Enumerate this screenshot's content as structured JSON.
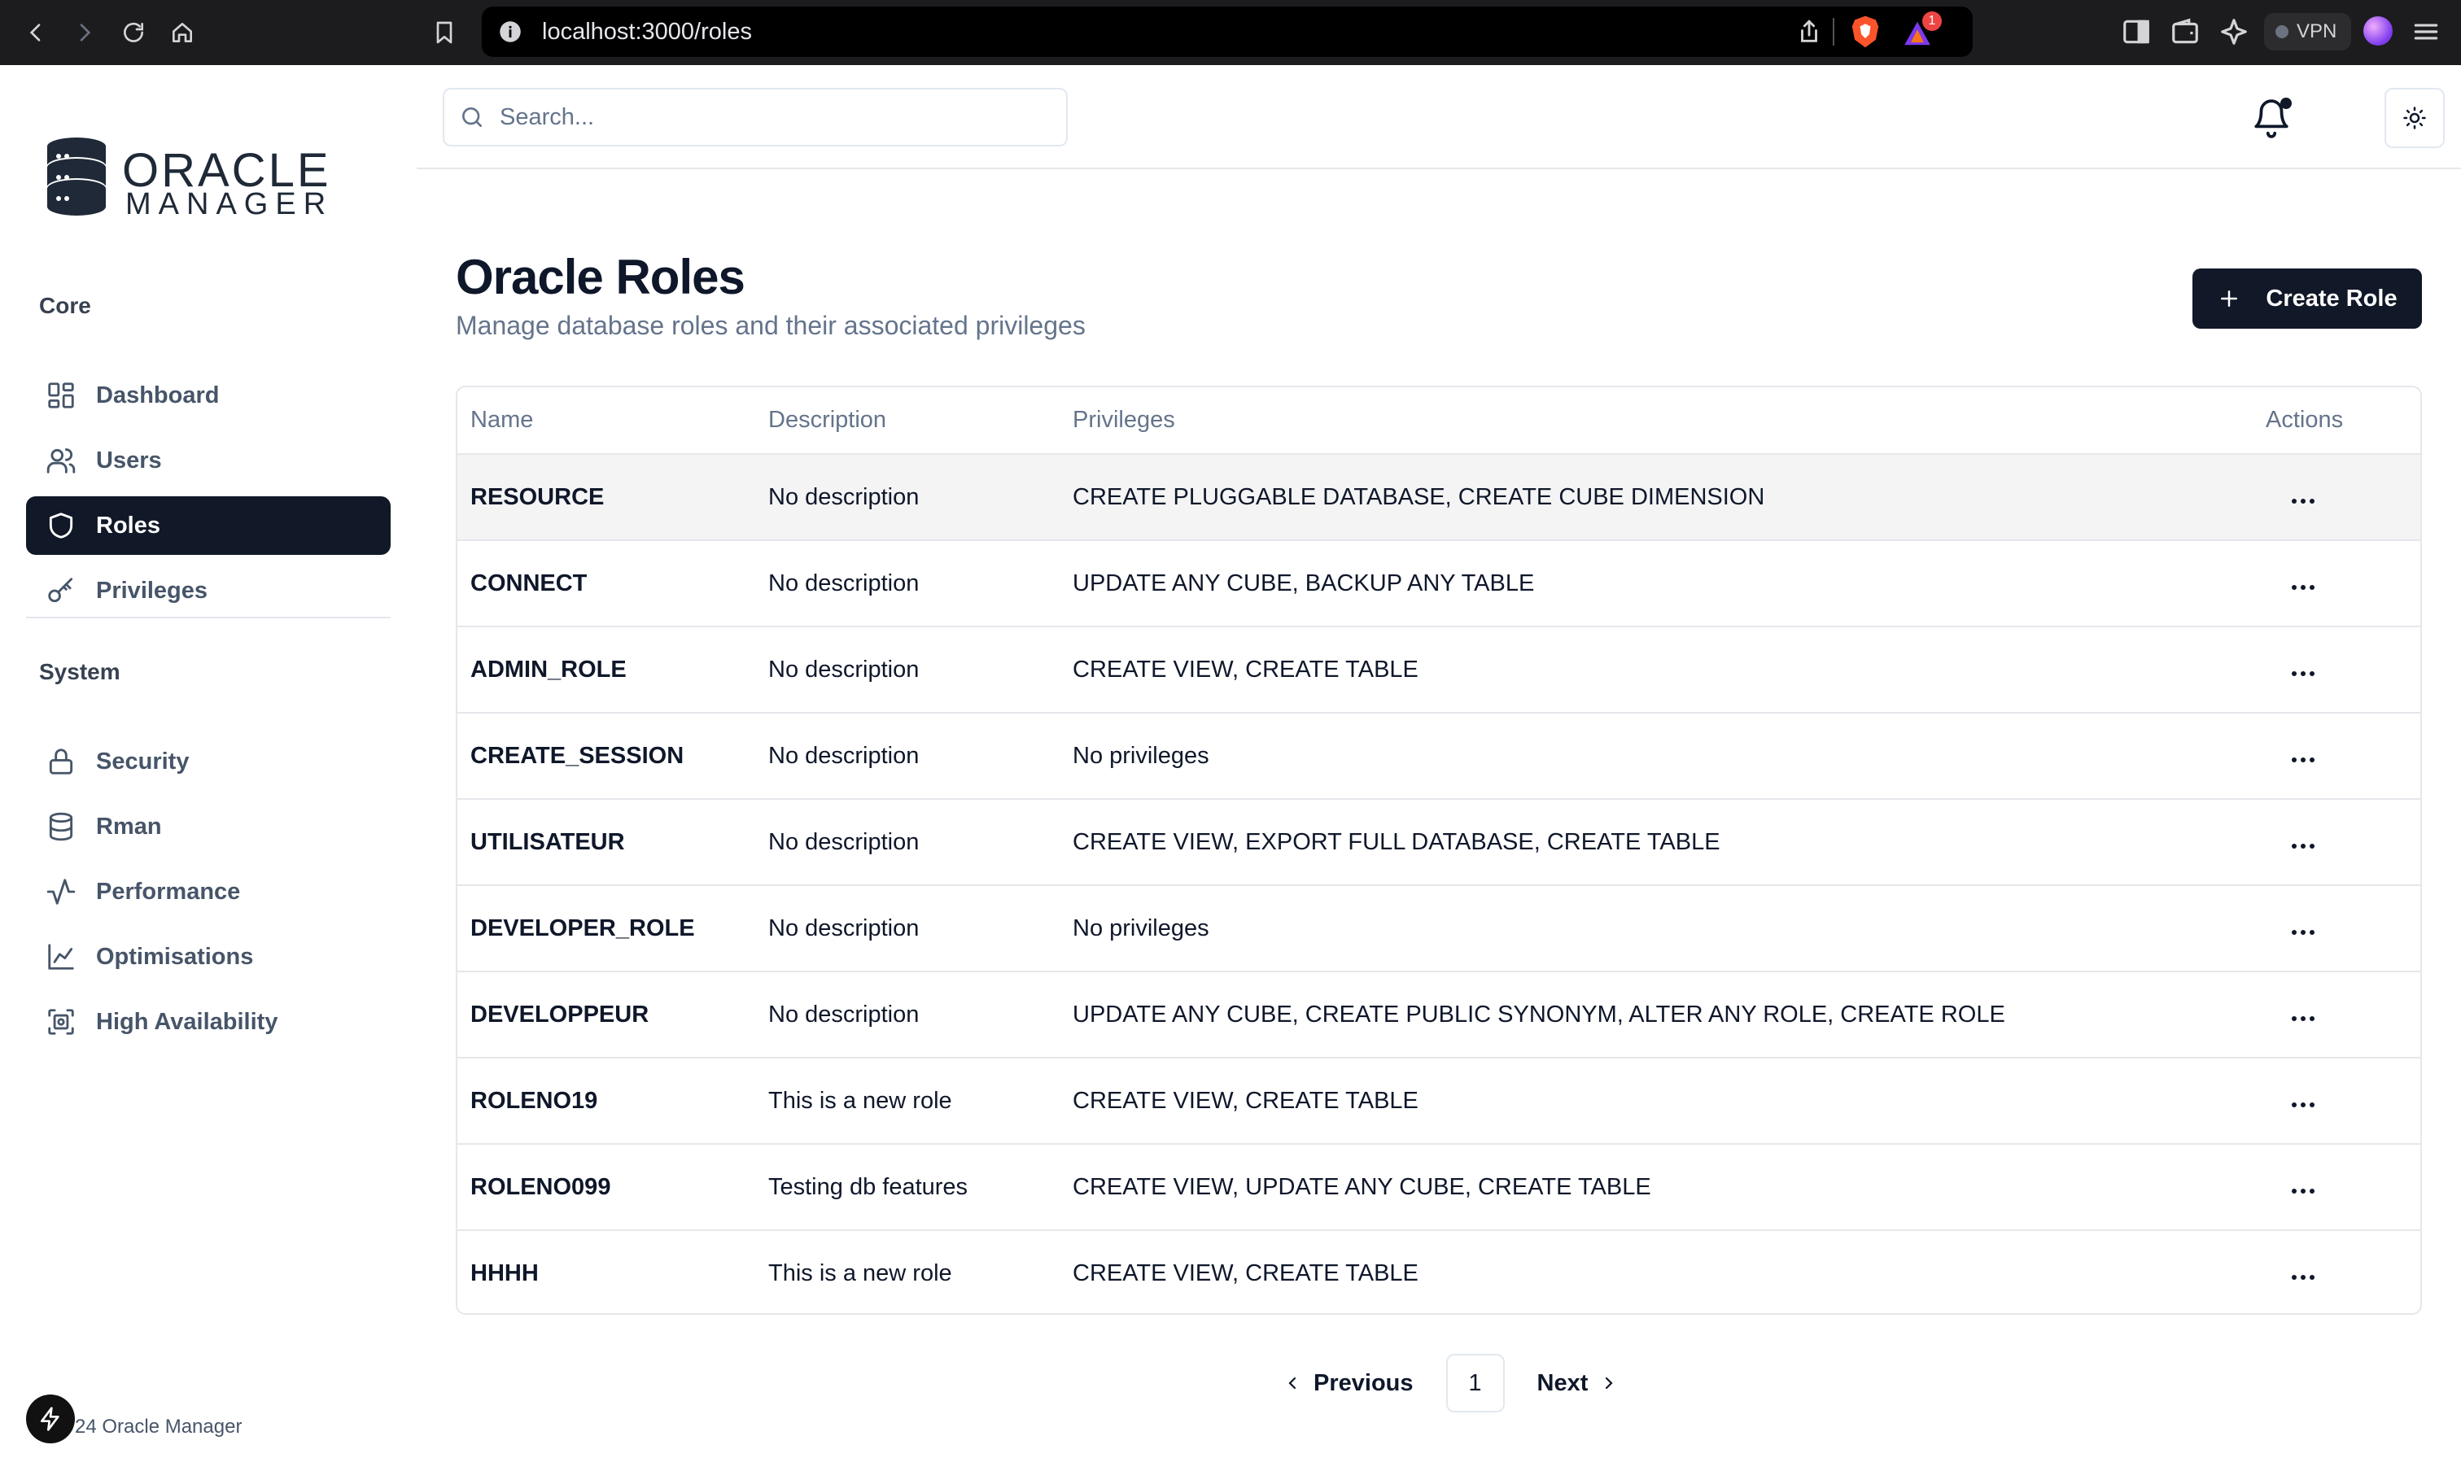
{
  "browser": {
    "url": "localhost:3000/roles",
    "vpn_label": "VPN",
    "rewards_badge": "1"
  },
  "brand": {
    "name_line1": "ORACLE",
    "name_line2": "MANAGER"
  },
  "sidebar": {
    "core_label": "Core",
    "core_items": [
      {
        "label": "Dashboard",
        "icon": "dashboard-icon"
      },
      {
        "label": "Users",
        "icon": "users-icon"
      },
      {
        "label": "Roles",
        "icon": "shield-icon",
        "active": true
      },
      {
        "label": "Privileges",
        "icon": "key-icon"
      }
    ],
    "system_label": "System",
    "system_items": [
      {
        "label": "Security",
        "icon": "lock-icon"
      },
      {
        "label": "Rman",
        "icon": "database-icon"
      },
      {
        "label": "Performance",
        "icon": "activity-icon"
      },
      {
        "label": "Optimisations",
        "icon": "line-chart-icon"
      },
      {
        "label": "High Availability",
        "icon": "server-icon"
      }
    ],
    "footer": "24 Oracle Manager"
  },
  "topbar": {
    "search_placeholder": "Search..."
  },
  "main": {
    "title": "Oracle Roles",
    "subtitle": "Manage database roles and their associated privileges",
    "create_button": "Create Role"
  },
  "table": {
    "headers": {
      "name": "Name",
      "description": "Description",
      "privileges": "Privileges",
      "actions": "Actions"
    },
    "rows": [
      {
        "name": "RESOURCE",
        "description": "No description",
        "privileges": "CREATE PLUGGABLE DATABASE, CREATE CUBE DIMENSION"
      },
      {
        "name": "CONNECT",
        "description": "No description",
        "privileges": "UPDATE ANY CUBE, BACKUP ANY TABLE"
      },
      {
        "name": "ADMIN_ROLE",
        "description": "No description",
        "privileges": "CREATE VIEW, CREATE TABLE"
      },
      {
        "name": "CREATE_SESSION",
        "description": "No description",
        "privileges": "No privileges"
      },
      {
        "name": "UTILISATEUR",
        "description": "No description",
        "privileges": "CREATE VIEW, EXPORT FULL DATABASE, CREATE TABLE"
      },
      {
        "name": "DEVELOPER_ROLE",
        "description": "No description",
        "privileges": "No privileges"
      },
      {
        "name": "DEVELOPPEUR",
        "description": "No description",
        "privileges": "UPDATE ANY CUBE, CREATE PUBLIC SYNONYM, ALTER ANY ROLE, CREATE ROLE"
      },
      {
        "name": "ROLENO19",
        "description": "This is a new role",
        "privileges": "CREATE VIEW, CREATE TABLE"
      },
      {
        "name": "ROLENO099",
        "description": "Testing db features",
        "privileges": "CREATE VIEW, UPDATE ANY CUBE, CREATE TABLE"
      },
      {
        "name": "HHHH",
        "description": "This is a new role",
        "privileges": "CREATE VIEW, CREATE TABLE"
      }
    ]
  },
  "pagination": {
    "previous": "Previous",
    "current_page": "1",
    "next": "Next"
  },
  "colors": {
    "primary": "#111827",
    "muted_text": "#64748b",
    "border": "#e5e7eb",
    "row_hover": "#f4f4f5"
  }
}
